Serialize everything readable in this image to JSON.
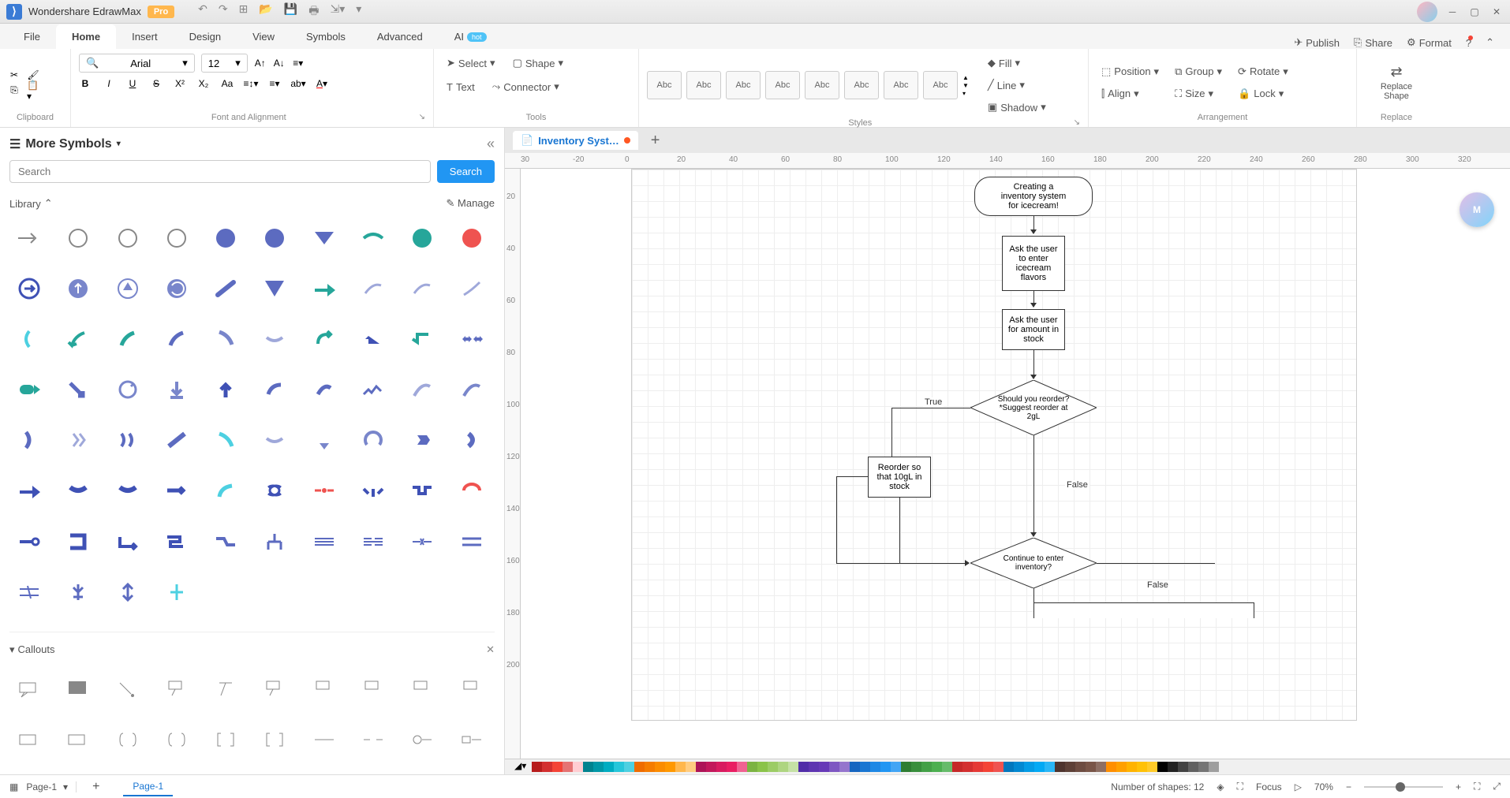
{
  "app": {
    "title": "Wondershare EdrawMax",
    "badge": "Pro"
  },
  "menu": {
    "tabs": [
      "File",
      "Home",
      "Insert",
      "Design",
      "View",
      "Symbols",
      "Advanced"
    ],
    "active": "Home",
    "ai_label": "AI",
    "ai_badge": "hot",
    "right": {
      "publish": "Publish",
      "share": "Share",
      "format": "Format"
    }
  },
  "ribbon": {
    "clipboard_label": "Clipboard",
    "font": {
      "family": "Arial",
      "size": "12",
      "label": "Font and Alignment"
    },
    "tools": {
      "select": "Select",
      "shape": "Shape",
      "text": "Text",
      "connector": "Connector",
      "label": "Tools"
    },
    "styles": {
      "sample": "Abc",
      "fill": "Fill",
      "line": "Line",
      "shadow": "Shadow",
      "label": "Styles"
    },
    "arrangement": {
      "position": "Position",
      "align": "Align",
      "group": "Group",
      "size": "Size",
      "rotate": "Rotate",
      "lock": "Lock",
      "label": "Arrangement"
    },
    "replace": {
      "btn": "Replace\nShape",
      "label": "Replace"
    }
  },
  "left_panel": {
    "title": "More Symbols",
    "search_placeholder": "Search",
    "search_btn": "Search",
    "library_label": "Library",
    "manage_label": "Manage",
    "section_callouts": "Callouts"
  },
  "document": {
    "tab_name": "Inventory Syst…",
    "modified": true
  },
  "ruler_h": [
    "30",
    "-20",
    "0",
    "20",
    "40",
    "60",
    "80",
    "100",
    "120",
    "140",
    "160",
    "180",
    "200",
    "220",
    "240",
    "260",
    "280",
    "300",
    "320"
  ],
  "ruler_v": [
    "20",
    "40",
    "60",
    "80",
    "100",
    "120",
    "140",
    "160",
    "180",
    "200"
  ],
  "flowchart": {
    "n1": "Creating a\ninventory system\nfor icecream!",
    "n2": "Ask the user\nto enter\nicecream\nflavors",
    "n3": "Ask the user\nfor amount in\nstock",
    "n4": "Should you reorder?\n*Suggest reorder at\n2gL",
    "n5": "Reorder so\nthat 10gL in\nstock",
    "n6": "Continue to enter\ninventory?",
    "label_true": "True",
    "label_false1": "False",
    "label_false2": "False"
  },
  "colors": [
    "#b71c1c",
    "#d32f2f",
    "#f44336",
    "#e57373",
    "#ffcdd2",
    "#00838f",
    "#0097a7",
    "#00acc1",
    "#26c6da",
    "#4dd0e1",
    "#ef6c00",
    "#f57c00",
    "#fb8c00",
    "#ff9800",
    "#ffb74d",
    "#ffcc80",
    "#ad1457",
    "#c2185b",
    "#d81b60",
    "#e91e63",
    "#f06292",
    "#7cb342",
    "#8bc34a",
    "#9ccc65",
    "#aed581",
    "#c5e1a5",
    "#512da8",
    "#5e35b1",
    "#673ab7",
    "#7e57c2",
    "#9575cd",
    "#1565c0",
    "#1976d2",
    "#1e88e5",
    "#2196f3",
    "#42a5f5",
    "#2e7d32",
    "#388e3c",
    "#43a047",
    "#4caf50",
    "#66bb6a",
    "#c62828",
    "#d32f2f",
    "#e53935",
    "#f44336",
    "#ef5350",
    "#0277bd",
    "#0288d1",
    "#039be5",
    "#03a9f4",
    "#29b6f6",
    "#4e342e",
    "#5d4037",
    "#6d4c41",
    "#795548",
    "#8d6e63",
    "#ff8f00",
    "#ffa000",
    "#ffb300",
    "#ffc107",
    "#ffca28",
    "#000000",
    "#212121",
    "#424242",
    "#616161",
    "#757575",
    "#9e9e9e"
  ],
  "status": {
    "page_selector": "Page-1",
    "page_tab": "Page-1",
    "shapes_count": "Number of shapes: 12",
    "focus": "Focus",
    "zoom": "70%"
  },
  "ai_fab": "M"
}
